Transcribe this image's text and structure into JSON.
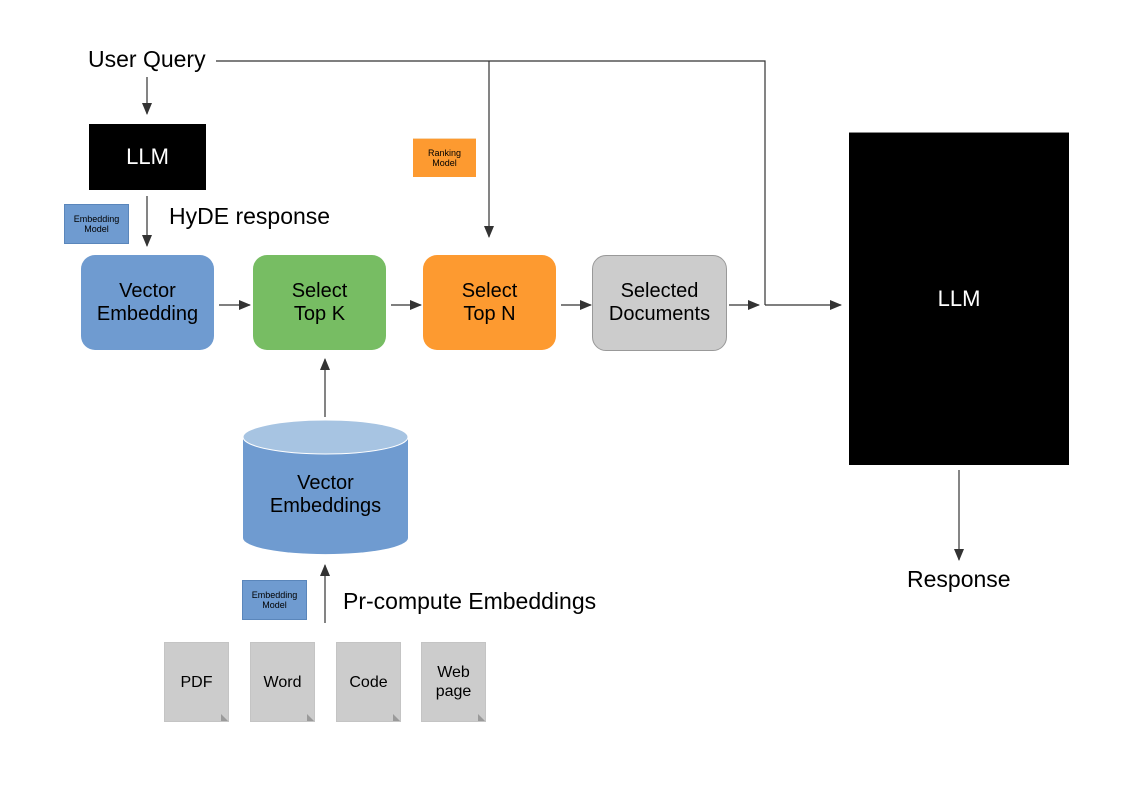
{
  "labels": {
    "user_query": "User Query",
    "hyde_response": "HyDE response",
    "precompute": "Pr-compute Embeddings",
    "response": "Response"
  },
  "nodes": {
    "llm_top": "LLM",
    "embedding_model_top": "Embedding Model",
    "ranking_model": "Ranking Model",
    "vector_embedding": "Vector Embedding",
    "select_top_k": "Select Top K",
    "select_top_n": "Select Top N",
    "selected_documents": "Selected Documents",
    "llm_main": "LLM",
    "vector_store": "Vector Embeddings",
    "embedding_model_bottom": "Embedding Model"
  },
  "documents": [
    "PDF",
    "Word",
    "Code",
    "Web page"
  ],
  "colors": {
    "blue": "#6f9bd0",
    "green": "#77bd63",
    "orange": "#fd9a30",
    "gray": "#cccccc",
    "black": "#000000",
    "cylinder_top": "#a7c4e2"
  }
}
